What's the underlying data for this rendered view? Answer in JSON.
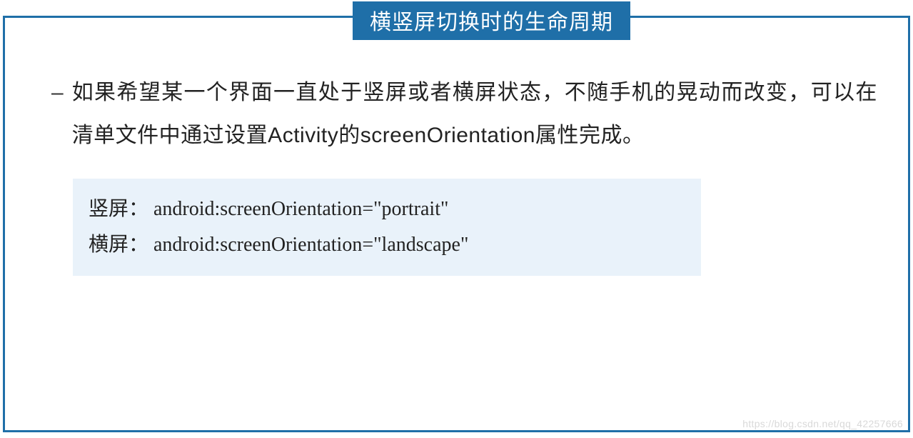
{
  "title": "横竖屏切换时的生命周期",
  "bullet": "–",
  "paragraph": "如果希望某一个界面一直处于竖屏或者横屏状态，不随手机的晃动而改变，可以在清单文件中通过设置Activity的screenOrientation属性完成。",
  "code": {
    "line1": "竖屏： android:screenOrientation=\"portrait\"",
    "line2": "横屏： android:screenOrientation=\"landscape\""
  },
  "watermark": "https://blog.csdn.net/qq_42257666"
}
